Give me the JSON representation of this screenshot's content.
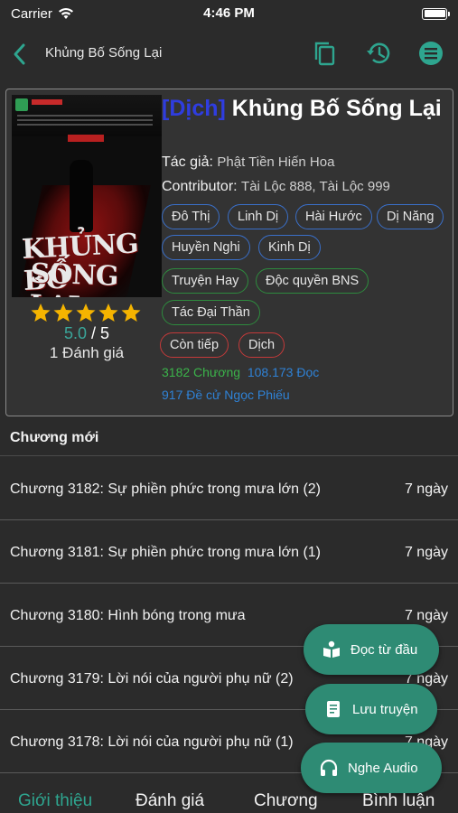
{
  "status_bar": {
    "carrier": "Carrier",
    "time": "4:46 PM"
  },
  "nav": {
    "title": "Khủng Bố Sống Lại"
  },
  "book": {
    "cover": {
      "title_line1": "KHỦNG BỐ",
      "title_line2": "SỐNG LẠI"
    },
    "title_prefix": "[Dịch]",
    "title": " Khủng Bố Sống Lại",
    "author_label": "Tác giả:",
    "author": "Phật Tiền Hiến Hoa",
    "contributor_label": "Contributor:",
    "contributors": "Tài Lộc 888, Tài Lộc 999",
    "rating": {
      "stars": 5,
      "score": "5.0",
      "separator": " / ",
      "max": "5",
      "count_text": "1 Đánh giá"
    },
    "genre_tags": [
      "Đô Thị",
      "Linh Dị",
      "Hài Hước",
      "Dị Năng",
      "Huyền Nghi",
      "Kinh Dị"
    ],
    "feature_tags": [
      "Truyện Hay",
      "Độc quyền BNS",
      "Tác Đại Thần"
    ],
    "status_tags": [
      "Còn tiếp",
      "Dịch"
    ],
    "stats": {
      "chapters": "3182 Chương",
      "reads": "108.173 Đọc",
      "nominations": "917 Đề cử Ngọc Phiếu"
    }
  },
  "chapters": {
    "section_title": "Chương mới",
    "items": [
      {
        "title": "Chương 3182: Sự phiền phức trong mưa lớn (2)",
        "time": "7 ngày"
      },
      {
        "title": "Chương 3181: Sự phiền phức trong mưa lớn (1)",
        "time": "7 ngày"
      },
      {
        "title": "Chương 3180: Hình bóng trong mưa",
        "time": "7 ngày"
      },
      {
        "title": "Chương 3179: Lời nói của người phụ nữ (2)",
        "time": "7 ngày"
      },
      {
        "title": "Chương 3178: Lời nói của người phụ nữ (1)",
        "time": "7 ngày"
      }
    ]
  },
  "fabs": {
    "read_from_start": "Đọc từ đầu",
    "save_story": "Lưu truyện",
    "listen_audio": "Nghe Audio"
  },
  "tabs": [
    "Giới thiệu",
    "Đánh giá",
    "Chương",
    "Bình luận"
  ],
  "colors": {
    "accent": "#2e8b74",
    "active_tab": "#2ea58f",
    "star": "#f5b400",
    "title_prefix": "#2f3ddf"
  },
  "icons": [
    "wifi-icon",
    "battery-icon",
    "back-chevron-icon",
    "copy-icon",
    "history-icon",
    "menu-icon",
    "star-icon",
    "book-reader-icon",
    "bookmark-icon",
    "headphones-icon"
  ]
}
